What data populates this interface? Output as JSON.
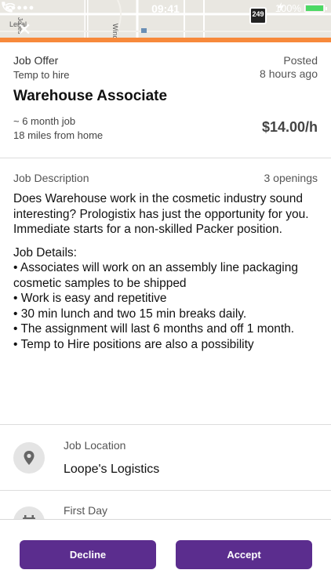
{
  "status_bar": {
    "carrier_signal": "●●●●●",
    "time": "09:41",
    "battery_percent": "100%"
  },
  "map": {
    "labels": [
      "Lenal",
      "Wind",
      "Jones"
    ],
    "speed_badge": "249"
  },
  "offer": {
    "type": "Job Offer",
    "subtype": "Temp to hire",
    "posted_label": "Posted",
    "posted_ago": "8 hours ago",
    "title": "Warehouse Associate",
    "duration": "~ 6 month job",
    "distance": "18 miles from home",
    "pay": "$14.00/h"
  },
  "description": {
    "label": "Job Description",
    "openings": "3 openings",
    "intro": "Does Warehouse work in the cosmetic industry sound interesting? Prologistix has just the opportunity for you. Immediate starts for a non-skilled Packer position.",
    "details_heading": "Job Details:",
    "bullets": [
      "• Associates will work on an assembly line packaging cosmetic samples to be shipped",
      "• Work is easy and repetitive",
      "• 30 min lunch and two 15 min breaks daily.",
      "• The assignment will last 6 months and off 1 month.",
      "• Temp to Hire positions are also a possibility"
    ]
  },
  "location": {
    "label": "Job Location",
    "value": "Loope's Logistics",
    "icon": "location-pin-icon"
  },
  "first_day": {
    "label": "First Day",
    "icon": "calendar-icon"
  },
  "footer": {
    "decline_label": "Decline",
    "accept_label": "Accept"
  },
  "colors": {
    "accent_orange": "#f7893b",
    "button_purple": "#5b2d8e",
    "battery_green": "#4cd964"
  }
}
